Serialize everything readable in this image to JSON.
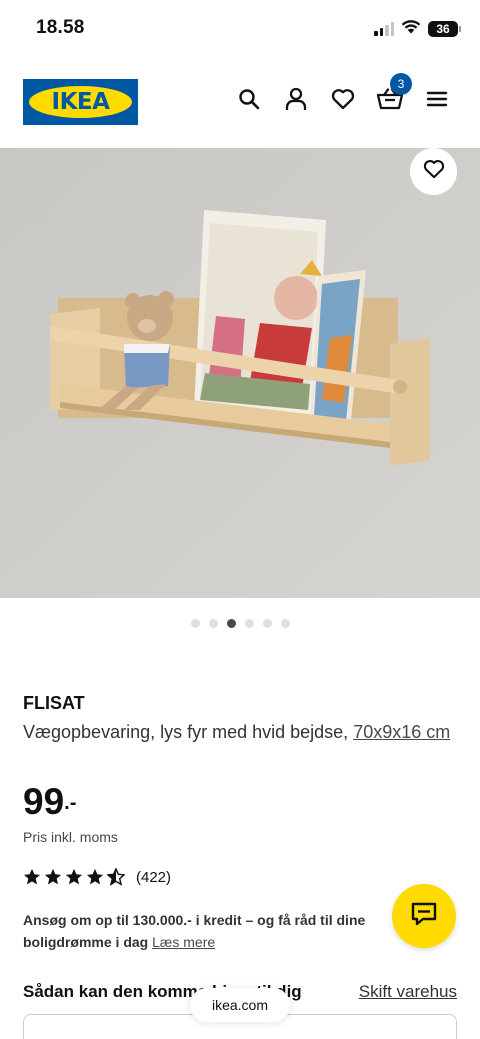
{
  "status_bar": {
    "time": "18.58",
    "battery": "36"
  },
  "header": {
    "logo_text": "IKEA",
    "cart_count": "3"
  },
  "carousel": {
    "total": 6,
    "active": 3
  },
  "product": {
    "name": "FLISAT",
    "description": "Vægopbevaring, lys fyr med hvid bejdse,",
    "dimensions": "70x9x16 cm",
    "price": "99",
    "price_suffix": ".-",
    "price_note": "Pris inkl. moms",
    "rating_value": 4.5,
    "rating_count": "(422)"
  },
  "credit": {
    "text": "Ansøg om op til 130.000.- i kredit – og få råd til dine boligdrømme i dag",
    "link": "Læs mere"
  },
  "availability": {
    "title": "Sådan kan den komme hjem til dig",
    "store_link": "Skift varehus"
  },
  "browser": {
    "url": "ikea.com"
  },
  "colors": {
    "brand_blue": "#0058a3",
    "brand_yellow": "#ffdb00"
  }
}
